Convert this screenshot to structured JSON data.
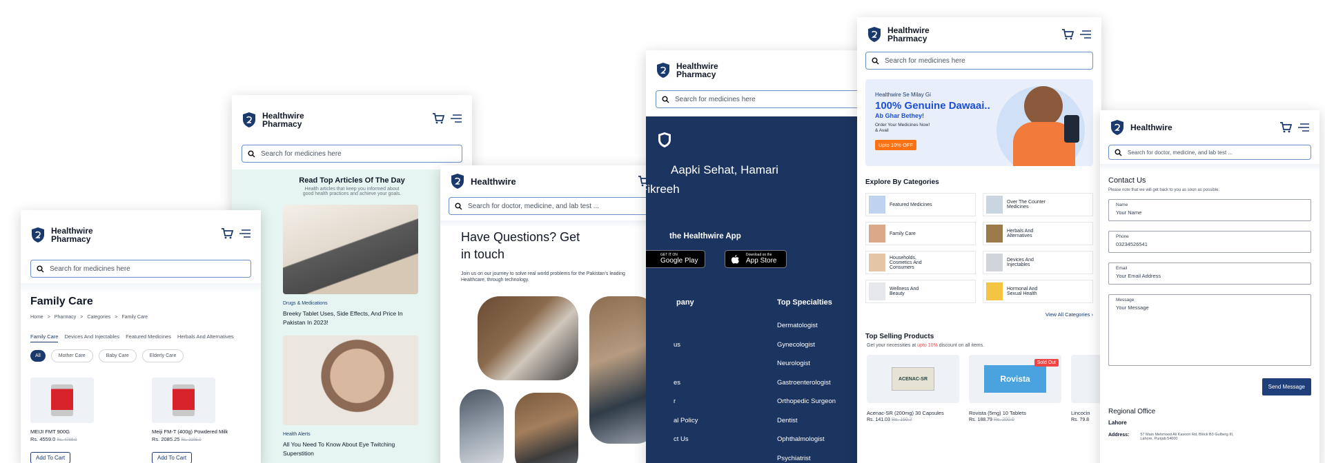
{
  "brand": {
    "name_two_line_1": "Healthwire",
    "name_two_line_2": "Pharmacy",
    "name_single": "Healthwire"
  },
  "search": {
    "medicines": "Search for medicines here",
    "doctor": "Search for doctor, medicine, and lab test ..."
  },
  "family_care": {
    "title": "Family Care",
    "breadcrumb": [
      "Home",
      ">",
      "Pharmacy",
      ">",
      "Categories",
      ">",
      "Family Care"
    ],
    "tabs": [
      "Family Care",
      "Devices And Injectables",
      "Featured Medicines",
      "Herbals And Alternatives"
    ],
    "chips": [
      "All",
      "Mother Care",
      "Baby Care",
      "Elderly Care"
    ],
    "products": [
      {
        "name": "MEIJI FMT 900G",
        "price": "Rs. 4559.0",
        "old_price": "Rs. 4799.0",
        "cta": "Add To Cart"
      },
      {
        "name": "Meiji FM-T (400g) Powdered Milk",
        "price": "Rs. 2085.25",
        "old_price": "Rs. 2195.0",
        "cta": "Add To Cart"
      }
    ]
  },
  "articles": {
    "title": "Read Top Articles Of The Day",
    "subtitle_1": "Health articles that keep you informed about",
    "subtitle_2": "good health practices and achieve your goals.",
    "items": [
      {
        "tag": "Drugs & Medications",
        "title_1": "Breeky Tablet Uses, Side Effects, And Price In",
        "title_2": "Pakistan In 2023!"
      },
      {
        "tag": "Health Alerts",
        "title_1": "All You Need To Know About Eye Twitching",
        "title_2": "Superstition"
      }
    ]
  },
  "questions": {
    "title_1": "Have Questions? Get",
    "title_2": "in touch",
    "body_1": "Join us on our journey to solve real world problems for the Pakistan's leading",
    "body_2": "Healthcare, through technology."
  },
  "footer": {
    "tagline_1": "Aapki Sehat, Hamari",
    "tagline_2": "Fikreeh",
    "tagline_1_visible": "r Aapki Sehat, Hamari",
    "tagline_1_shown": "Aapki Sehat, Hamari",
    "app_heading": "the Healthwire App",
    "google_small": "GET IT ON",
    "google_big": "Google Play",
    "apple_small": "Download on the",
    "apple_big": "App Store",
    "company_heading": "pany",
    "company_links": [
      "",
      "us",
      "",
      "es",
      "r",
      "al Policy",
      "ct Us"
    ],
    "specialties_heading": "Top Specialties",
    "specialties": [
      "Dermatologist",
      "Gynecologist",
      "Neurologist",
      "Gastroenterologist",
      "Orthopedic Surgeon",
      "Dentist",
      "Ophthalmologist",
      "Psychiatrist"
    ]
  },
  "pharmacy_home": {
    "banner_small": "Healthwire Se Milay Gi",
    "banner_big_1": "100% Genuine Dawaai..",
    "banner_big_2": "Ab Ghar Bethey!",
    "banner_order_1": "Order Your Medicines Now!",
    "banner_order_2": "& Avail",
    "banner_badge": "Upto 10% OFF",
    "categories_heading": "Explore By Categories",
    "categories": [
      [
        "Featured Medicines"
      ],
      [
        "Over The Counter",
        "Medicines"
      ],
      [
        "Family Care"
      ],
      [
        "Herbals And",
        "Alternatives"
      ],
      [
        "Households,",
        "Cosmetics And",
        "Consumers"
      ],
      [
        "Devices And",
        "Injectables"
      ],
      [
        "Wellness And",
        "Beauty"
      ],
      [
        "Hormonal And",
        "Sexual Health"
      ]
    ],
    "view_all": "View All Categories",
    "top_heading": "Top Selling Products",
    "top_sub_1": "Get your necessities at",
    "top_sub_hl": "upto 10%",
    "top_sub_2": "discount on all items.",
    "products": [
      {
        "name": "Acenac-SR (200mg) 30 Capsules",
        "price": "Rs. 141.03",
        "old_price": "Rs. 150.7",
        "box": "ACENAC-SR"
      },
      {
        "name": "Rovista (5mg) 10 Tablets",
        "price": "Rs. 188.79",
        "old_price": "Rs. 200.0",
        "box": "Rovista",
        "badge": "Sold Out"
      },
      {
        "name": "Lincocin",
        "price": "Rs. 79.8"
      }
    ]
  },
  "contact": {
    "title": "Contact Us",
    "subtitle": "Please note that we will get back to you as soon as possible.",
    "fields": [
      {
        "label": "Name",
        "placeholder": "Your Name"
      },
      {
        "label": "Phone",
        "placeholder": "03234526541"
      },
      {
        "label": "Email",
        "placeholder": "Your Email Address"
      },
      {
        "label": "Message",
        "placeholder": "Your Message"
      }
    ],
    "send": "Send Message",
    "office_heading": "Regional Office",
    "city": "Lahore",
    "address_label": "Address:",
    "address_1": "57 Main Mehmood Ali Kasoori Rd, Block B3 Gulberg III,",
    "address_2": "Lahore, Punjab 54000"
  },
  "colors": {
    "navy": "#1a3a6e",
    "accent_blue": "#2563eb",
    "orange": "#f97316",
    "red": "#ef4444",
    "mint": "#e6f5f1"
  }
}
